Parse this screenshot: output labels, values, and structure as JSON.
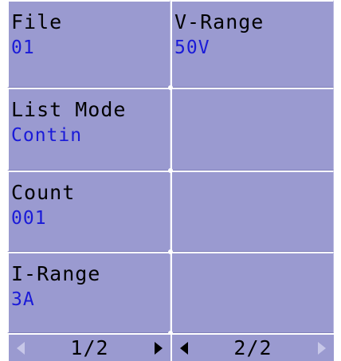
{
  "cells": {
    "file": {
      "label": "File",
      "value": "01"
    },
    "v_range": {
      "label": "V-Range",
      "value": "50V"
    },
    "list_mode": {
      "label": "List Mode",
      "value": "Contin"
    },
    "count": {
      "label": "Count",
      "value": "001"
    },
    "i_range": {
      "label": "I-Range",
      "value": "3A"
    }
  },
  "pager": {
    "left_page": "1/2",
    "right_page": "2/2"
  },
  "colors": {
    "background": "#9a9ad0",
    "label": "#000000",
    "value": "#1a1ad8",
    "divider": "#ffffff",
    "arrow_disabled": "#c7c7e8"
  },
  "icons": {
    "prev": "triangle-left",
    "next": "triangle-right"
  }
}
